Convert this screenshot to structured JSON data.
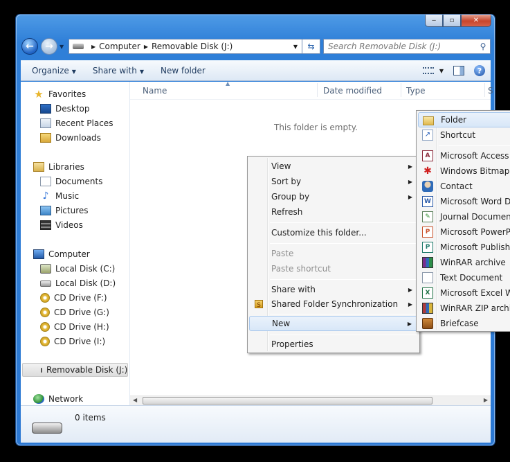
{
  "window": {
    "caption_buttons": {
      "minimize": "‒",
      "maximize": "▫",
      "close": "✕"
    }
  },
  "address": {
    "segments": [
      "Computer",
      "Removable Disk (J:)"
    ]
  },
  "search": {
    "placeholder": "Search Removable Disk (J:)"
  },
  "toolbar": {
    "organize": "Organize",
    "share_with": "Share with",
    "new_folder": "New folder",
    "help": "?"
  },
  "nav": {
    "favorites": "Favorites",
    "desktop": "Desktop",
    "recent_places": "Recent Places",
    "downloads": "Downloads",
    "libraries": "Libraries",
    "documents": "Documents",
    "music": "Music",
    "pictures": "Pictures",
    "videos": "Videos",
    "computer": "Computer",
    "local_c": "Local Disk (C:)",
    "local_d": "Local Disk (D:)",
    "cd_f": "CD Drive (F:)",
    "cd_g": "CD Drive (G:)",
    "cd_h": "CD Drive (H:)",
    "cd_i": "CD Drive (I:)",
    "removable_j": "Removable Disk (J:)",
    "network": "Network"
  },
  "columns": {
    "name": "Name",
    "date_modified": "Date modified",
    "type": "Type",
    "size": "S"
  },
  "empty_message": "This folder is empty.",
  "details": {
    "item_count": "0 items"
  },
  "context_menu": {
    "view": "View",
    "sort_by": "Sort by",
    "group_by": "Group by",
    "refresh": "Refresh",
    "customize": "Customize this folder...",
    "paste": "Paste",
    "paste_shortcut": "Paste shortcut",
    "share_with": "Share with",
    "shared_sync": "Shared Folder Synchronization",
    "new": "New",
    "properties": "Properties"
  },
  "new_submenu": {
    "folder": "Folder",
    "shortcut": "Shortcut",
    "access": "Microsoft Access D",
    "bitmap": "Windows Bitmap In",
    "contact": "Contact",
    "word": "Microsoft Word Do",
    "journal": "Journal Document",
    "powerpoint": "Microsoft PowerPo",
    "publisher": "Microsoft Publisher",
    "winrar": "WinRAR archive",
    "text": "Text Document",
    "excel": "Microsoft Excel Wo",
    "winrar_zip": "WinRAR ZIP archive",
    "briefcase": "Briefcase"
  },
  "colors": {
    "frame": "#2f7fd8",
    "menu_bg": "#f5f5f5",
    "hover": "#d8e7f8"
  }
}
